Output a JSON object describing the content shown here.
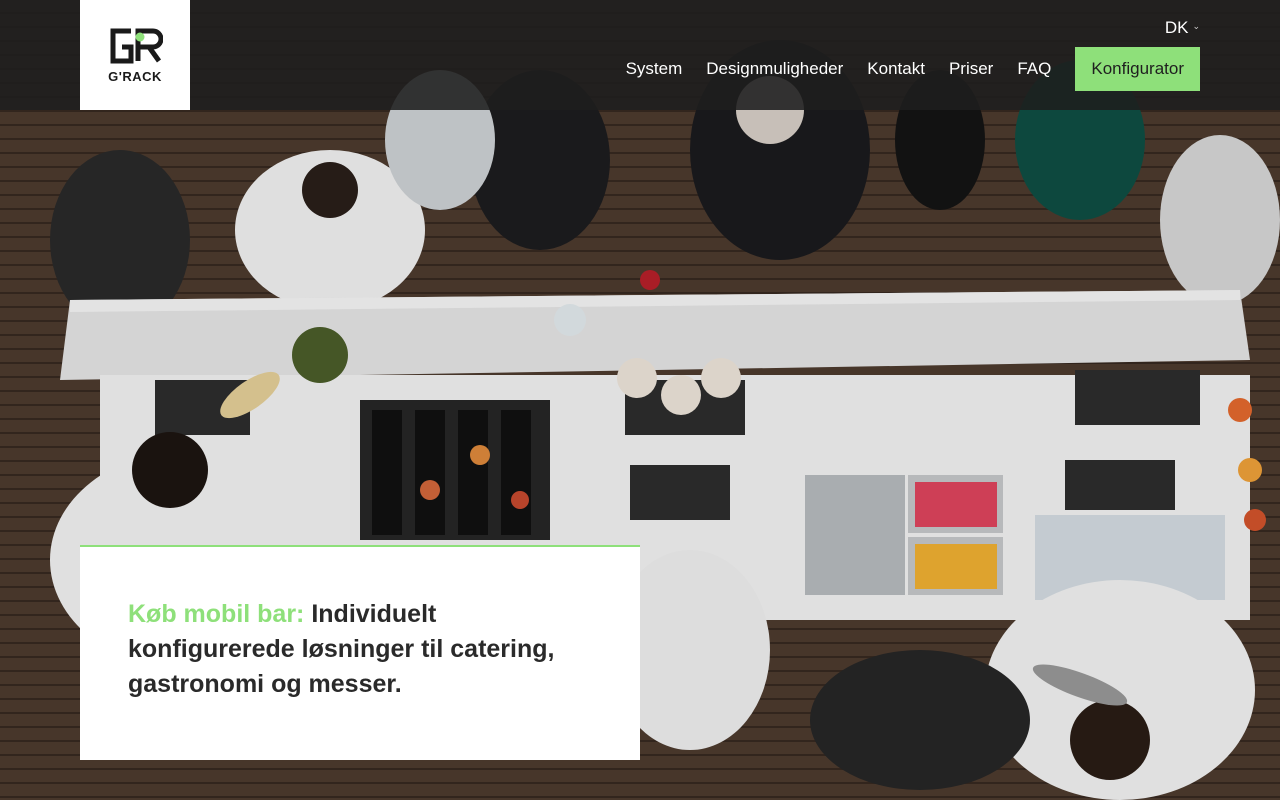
{
  "header": {
    "logo": {
      "mark": "GR",
      "word": "G'RACK"
    },
    "language": {
      "label": "DK",
      "icon": "chevron-down-icon"
    },
    "nav": [
      {
        "label": "System"
      },
      {
        "label": "Designmuligheder"
      },
      {
        "label": "Kontakt"
      },
      {
        "label": "Priser"
      },
      {
        "label": "FAQ"
      }
    ],
    "cta_label": "Konfigurator"
  },
  "hero": {
    "accent_text": "Køb mobil bar:",
    "headline_rest": "Individuelt konfigurerede løsninger til catering, gastronomi og messer."
  },
  "colors": {
    "accent": "#8ee07a",
    "header_bg": "#1e1e1e",
    "card_bg": "#ffffff",
    "headline": "#2a2a2a"
  }
}
